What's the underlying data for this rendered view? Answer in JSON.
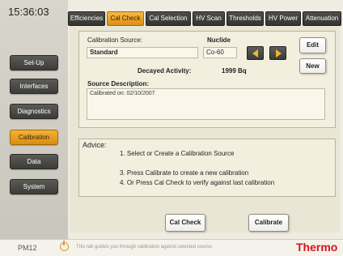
{
  "clock": "15:36:03",
  "tabs": [
    {
      "label": "Efficiencies",
      "active": false
    },
    {
      "label": "Cal Check",
      "active": true
    },
    {
      "label": "Cal Selection",
      "active": false
    },
    {
      "label": "HV Scan",
      "active": false
    },
    {
      "label": "Thresholds",
      "active": false
    },
    {
      "label": "HV Power",
      "active": false
    },
    {
      "label": "Attenuation",
      "active": false
    }
  ],
  "sidebar": {
    "items": [
      {
        "label": "Set-Up",
        "active": false
      },
      {
        "label": "Interfaces",
        "active": false
      },
      {
        "label": "Diagnostics",
        "active": false
      },
      {
        "label": "Calibration",
        "active": true
      },
      {
        "label": "Data",
        "active": false
      },
      {
        "label": "System",
        "active": false
      }
    ]
  },
  "source": {
    "calibration_source_label": "Calibration Source:",
    "calibration_source_value": "Standard",
    "nuclide_label": "Nuclide",
    "nuclide_value": "Co-60",
    "decayed_activity_label": "Decayed Activity:",
    "decayed_activity_value": "1999 Bq",
    "description_label": "Source Description:",
    "description_value": "Calibrated on: 02/10/2007",
    "edit_label": "Edit",
    "new_label": "New",
    "prev_icon": "arrow-left-icon",
    "next_icon": "arrow-right-icon"
  },
  "advice": {
    "title": "Advice:",
    "lines": [
      "1.  Select or Create a Calibration Source",
      "3.  Press Calibrate to create a new calibration",
      "4.  Or Press Cal Check to verify against last calibration"
    ]
  },
  "actions": {
    "cal_check_label": "Cal Check",
    "calibrate_label": "Calibrate"
  },
  "footer": {
    "model": "PM12",
    "hint": "This tab guides you through calibration against selected source.",
    "logo": "Thermo",
    "power_icon": "power-icon"
  },
  "colors": {
    "accent": "#f2b23a",
    "nav_dark": "#3c3c39",
    "logo_red": "#d4141c",
    "background": "#efece1"
  }
}
